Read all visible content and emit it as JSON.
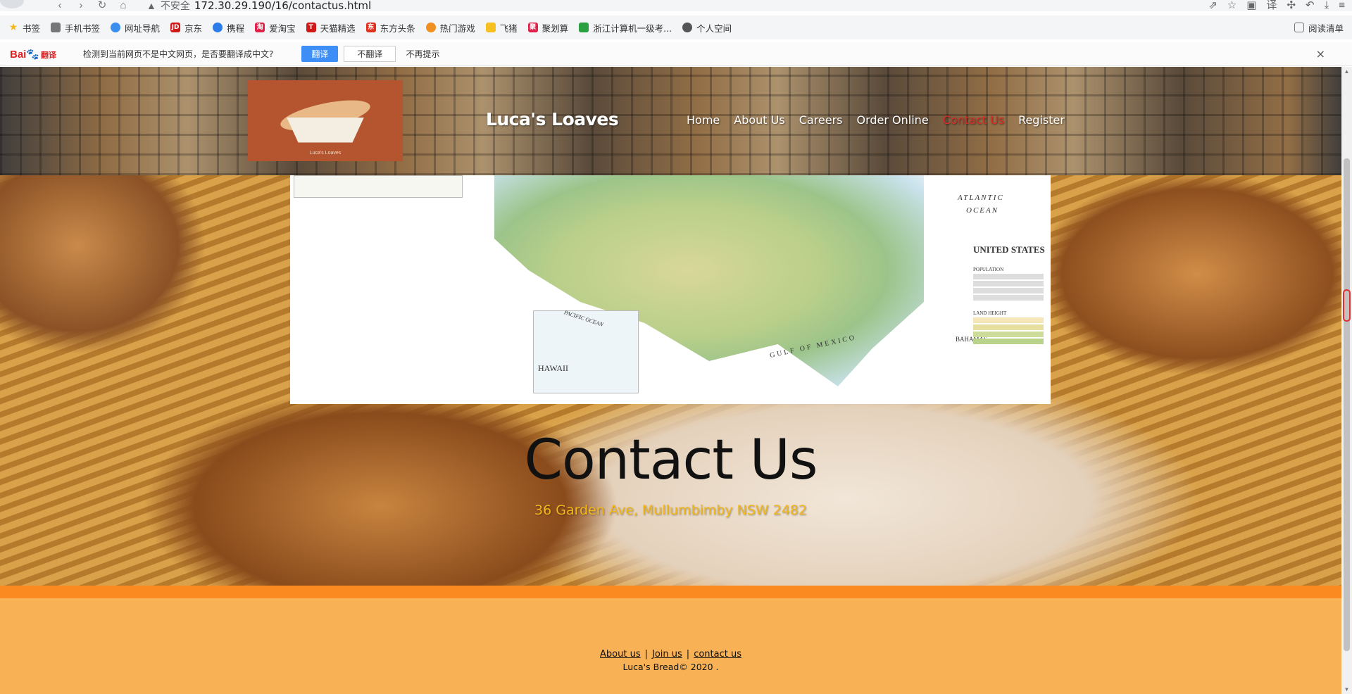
{
  "browser": {
    "url": "172.30.29.190/16/contactus.html",
    "security_label": "不安全",
    "bookmarks": [
      "书签",
      "手机书签",
      "网址导航",
      "京东",
      "携程",
      "爱淘宝",
      "天猫精选",
      "东方头条",
      "热门游戏",
      "飞猪",
      "聚划算",
      "浙江计算机一级考...",
      "个人空间"
    ],
    "reading_list": "阅读清单"
  },
  "translate_bar": {
    "logo_main": "Bai",
    "logo_sub": "翻译",
    "message": "检测到当前网页不是中文网页，是否要翻译成中文?",
    "translate_button": "翻译",
    "no_translate_button": "不翻译",
    "never_link": "不再提示",
    "close": "×"
  },
  "header": {
    "site_title": "Luca's Loaves",
    "logo_caption": "Luca's Loaves",
    "nav": [
      "Home",
      "About Us",
      "Careers",
      "Order Online",
      "Contact Us",
      "Register"
    ],
    "active_nav": "Contact Us"
  },
  "map": {
    "labels": {
      "atlantic": "ATLANTIC",
      "ocean": "OCEAN",
      "country": "UNITED STATES",
      "hawaii": "HAWAII",
      "pacific": "PACIFIC OCEAN",
      "gulf": "GULF OF MEXICO",
      "bahamas": "BAHAMAS",
      "population": "POPULATION",
      "land_height": "LAND HEIGHT"
    }
  },
  "contact": {
    "title": "Contact Us",
    "address": "36 Garden Ave, Mullumbimby NSW 2482"
  },
  "footer": {
    "links": [
      "About us",
      "Join us",
      "contact us"
    ],
    "separator": "|",
    "copyright": "Luca's Bread© 2020 ."
  },
  "colors": {
    "active_nav": "#e02a2a",
    "address": "#f5b81a",
    "footer_band": "#fb8a20",
    "footer_bg": "#f8b255"
  }
}
